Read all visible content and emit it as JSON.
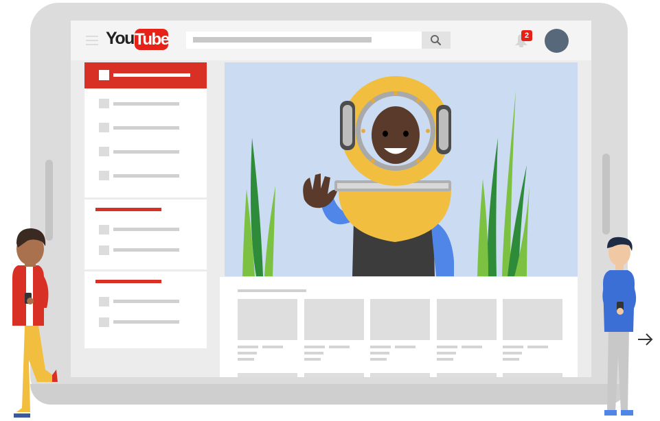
{
  "header": {
    "logo_you": "You",
    "logo_tube": "Tube",
    "notification_count": "2"
  },
  "icons": {
    "menu": "hamburger-menu-icon",
    "search": "search-icon",
    "notifications": "bell-icon",
    "next": "arrow-right-icon"
  },
  "colors": {
    "brand_red": "#e62117",
    "video_background": "#cadbf2",
    "helmet_yellow": "#f2be3f",
    "avatar": "#56687a"
  }
}
